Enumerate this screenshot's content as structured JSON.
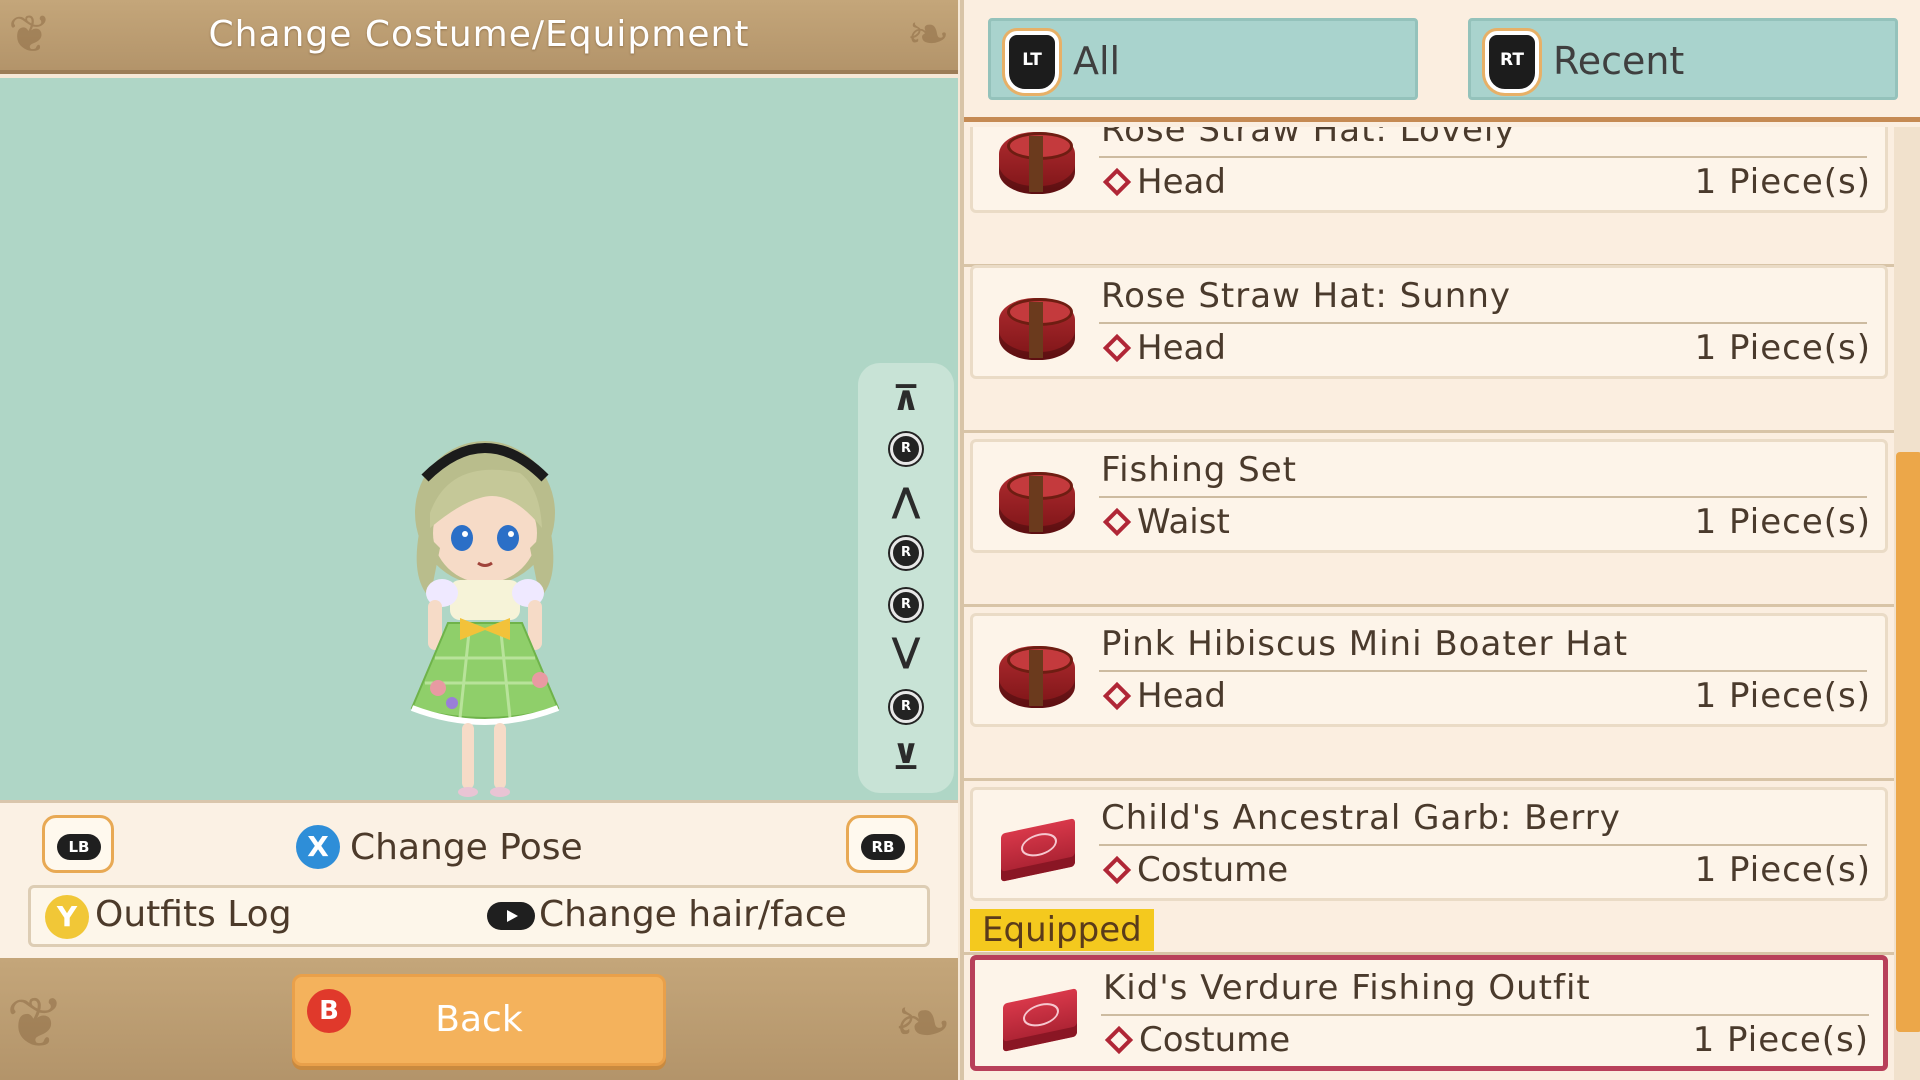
{
  "header": {
    "title": "Change Costume/Equipment"
  },
  "camera_controls": {
    "top": "⊼",
    "up_stick": "R",
    "up": "⋀",
    "left_stick": "R",
    "right_stick": "R",
    "down": "⋁",
    "down_stick": "R",
    "bottom": "⊻"
  },
  "bottom_bar": {
    "lb_label": "LB",
    "rb_label": "RB",
    "x_label": "X",
    "change_pose": "Change Pose",
    "y_label": "Y",
    "outfits_log": "Outfits Log",
    "change_hair_face": "Change hair/face"
  },
  "footer": {
    "b_label": "B",
    "back": "Back"
  },
  "tabs": [
    {
      "button": "LT",
      "label": "All"
    },
    {
      "button": "RT",
      "label": "Recent"
    }
  ],
  "items": [
    {
      "name": "Rose Straw Hat: Lovely",
      "category": "Head",
      "quantity": "1 Piece(s)",
      "icon": "hatbox-icon"
    },
    {
      "name": "Rose Straw Hat: Sunny",
      "category": "Head",
      "quantity": "1 Piece(s)",
      "icon": "hatbox-icon"
    },
    {
      "name": "Fishing Set",
      "category": "Waist",
      "quantity": "1 Piece(s)",
      "icon": "hatbox-icon"
    },
    {
      "name": "Pink Hibiscus Mini Boater Hat",
      "category": "Head",
      "quantity": "1 Piece(s)",
      "icon": "hatbox-icon"
    },
    {
      "name": "Child's Ancestral Garb: Berry",
      "category": "Costume",
      "quantity": "1 Piece(s)",
      "icon": "gift-case-icon"
    },
    {
      "name": "Kid's Verdure Fishing Outfit",
      "category": "Costume",
      "quantity": "1 Piece(s)",
      "icon": "gift-case-icon",
      "equipped": true
    }
  ],
  "equipped_label": "Equipped",
  "colors": {
    "stage": "#afd6c6",
    "accent": "#eca749",
    "equipped_border": "#b8405a",
    "tab": "#a9d3cd"
  }
}
